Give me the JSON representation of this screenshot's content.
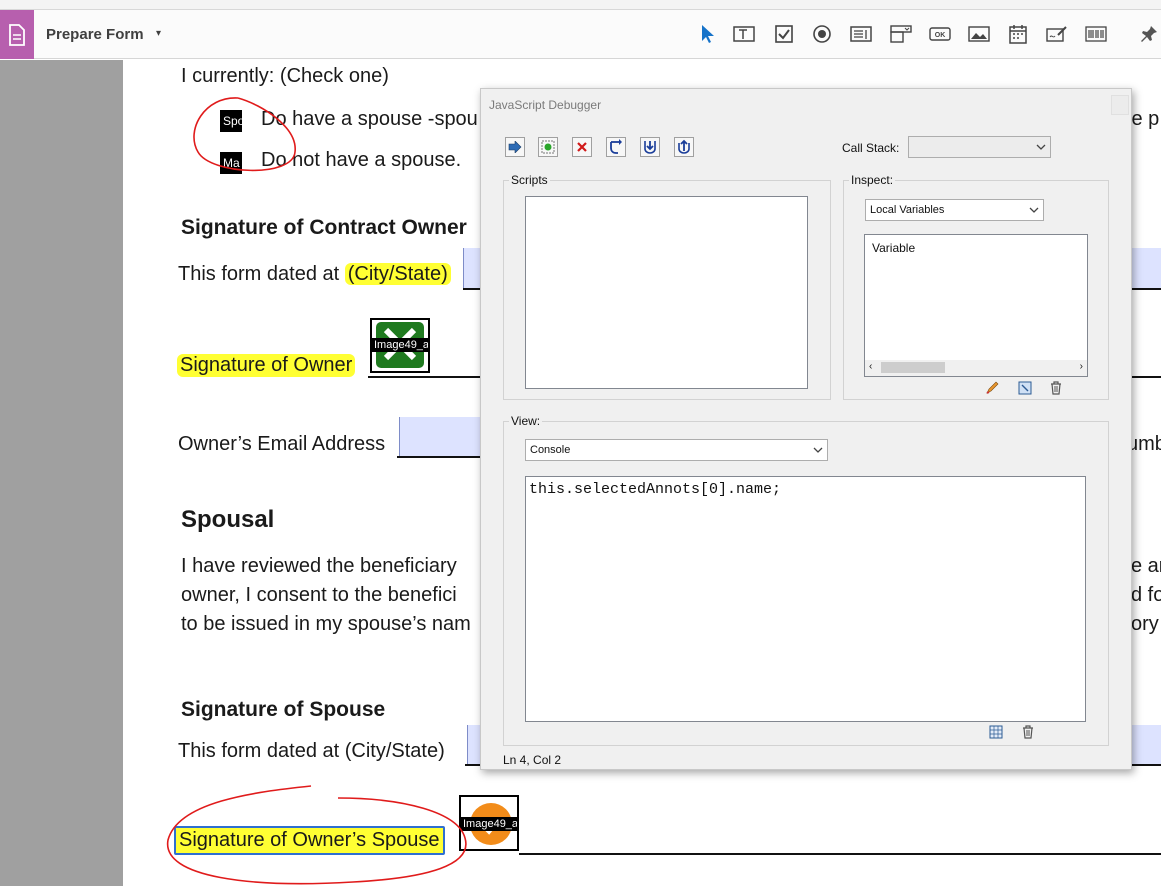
{
  "toolbar": {
    "tool_name": "Prepare Form",
    "tool_caret": "▾",
    "icons": [
      "select-arrow-icon",
      "text-field-icon",
      "checkbox-icon",
      "radio-button-icon",
      "list-box-icon",
      "dropdown-icon",
      "button-icon",
      "image-icon",
      "date-field-icon",
      "digital-signature-icon",
      "barcode-icon",
      "pin-icon"
    ]
  },
  "document": {
    "line_check": "I currently: (Check one)",
    "opt1_check": "Spo",
    "opt1_text": "Do have a spouse -spou",
    "opt1_overflow": "le p",
    "opt2_check": "Ma",
    "opt2_text": "Do not have a spouse.",
    "sig_contract_heading": "Signature of Contract Owner",
    "form_dated_prefix": "This form dated at ",
    "city_state": "(City/State)",
    "sig_owner_label": "Signature of Owner",
    "image_field_1": "Image49_a",
    "email_label": "Owner’s Email Address",
    "email_overflow": "umb",
    "spousal_heading": "Spousal",
    "para_line1": "I have reviewed the beneficiary",
    "para_line2": "owner, I consent to the benefici",
    "para_line3": "to be issued in my spouse’s nam",
    "para_over1": "e ar",
    "para_over2": "d fo",
    "para_over3": "ory",
    "sig_spouse_heading": "Signature of Spouse",
    "spouse_dated": "This form dated at (City/State)",
    "sig_spouse_label": "Signature of Owner’s Spouse",
    "image_field_2": "Image49_a"
  },
  "debugger": {
    "title": "JavaScript Debugger",
    "buttons": [
      "resume-icon",
      "breakpoint-icon",
      "clear-icon",
      "step-over-icon",
      "step-into-icon",
      "step-out-icon"
    ],
    "call_stack_label": "Call Stack:",
    "call_stack_value": "",
    "scripts_label": "Scripts",
    "inspect_label": "Inspect:",
    "inspect_select": "Local Variables",
    "variable_header": "Variable",
    "view_label": "View:",
    "view_select": "Console",
    "console_text": "this.selectedAnnots[0].name;",
    "status": "Ln 4, Col 2"
  },
  "colors": {
    "highlight": "#ffff33",
    "field_fill": "#dde3ff",
    "annotation_red": "#e01b1b",
    "tool_accent": "#b75fae"
  }
}
